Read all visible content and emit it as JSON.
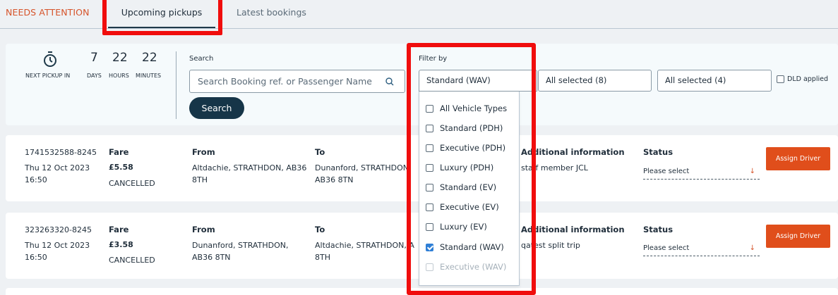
{
  "tabs": {
    "needs_attention": "NEEDS ATTENTION",
    "upcoming": "Upcoming pickups",
    "latest": "Latest bookings"
  },
  "countdown": {
    "caption": "NEXT PICKUP IN",
    "days": "7",
    "days_label": "DAYS",
    "hours": "22",
    "hours_label": "HOURS",
    "minutes": "22",
    "minutes_label": "MINUTES"
  },
  "search": {
    "label": "Search",
    "placeholder": "Search Booking ref. or Passenger Name",
    "button": "Search"
  },
  "filter": {
    "label": "Filter by",
    "vehicle_selected": "Standard (WAV)",
    "select2": "All selected (8)",
    "select3": "All selected (4)",
    "dld_label": "DLD applied",
    "options": [
      {
        "label": "All Vehicle Types",
        "checked": false,
        "disabled": false
      },
      {
        "label": "Standard (PDH)",
        "checked": false,
        "disabled": false
      },
      {
        "label": "Executive (PDH)",
        "checked": false,
        "disabled": false
      },
      {
        "label": "Luxury (PDH)",
        "checked": false,
        "disabled": false
      },
      {
        "label": "Standard (EV)",
        "checked": false,
        "disabled": false
      },
      {
        "label": "Executive (EV)",
        "checked": false,
        "disabled": false
      },
      {
        "label": "Luxury (EV)",
        "checked": false,
        "disabled": false
      },
      {
        "label": "Standard (WAV)",
        "checked": true,
        "disabled": false
      },
      {
        "label": "Executive (WAV)",
        "checked": false,
        "disabled": true
      }
    ]
  },
  "labels": {
    "fare": "Fare",
    "from": "From",
    "to": "To",
    "additional": "Additional information",
    "status": "Status",
    "status_placeholder": "Please select",
    "assign": "Assign Driver"
  },
  "bookings": [
    {
      "ref": "1741532588-8245",
      "date": "Thu 12 Oct 2023",
      "time": "16:50",
      "fare": "£5.58",
      "fare_status": "CANCELLED",
      "from_1": "Altdachie, STRATHDON, AB36",
      "from_2": "8TH",
      "to_1": "Dunanford, STRATHDON",
      "to_2": "AB36 8TN",
      "info": "staff member JCL"
    },
    {
      "ref": "323263320-8245",
      "date": "Thu 12 Oct 2023",
      "time": "16:50",
      "fare": "£3.58",
      "fare_status": "CANCELLED",
      "from_1": "Dunanford, STRATHDON,",
      "from_2": "AB36 8TN",
      "to_1": "Altdachie, STRATHDON, A",
      "to_2": "8TH",
      "info": "qatest split trip"
    }
  ],
  "colors": {
    "accent_orange": "#e04e1b",
    "navy": "#163548",
    "highlight_red": "#f00d0d",
    "checkbox_blue": "#2f7fd6"
  }
}
